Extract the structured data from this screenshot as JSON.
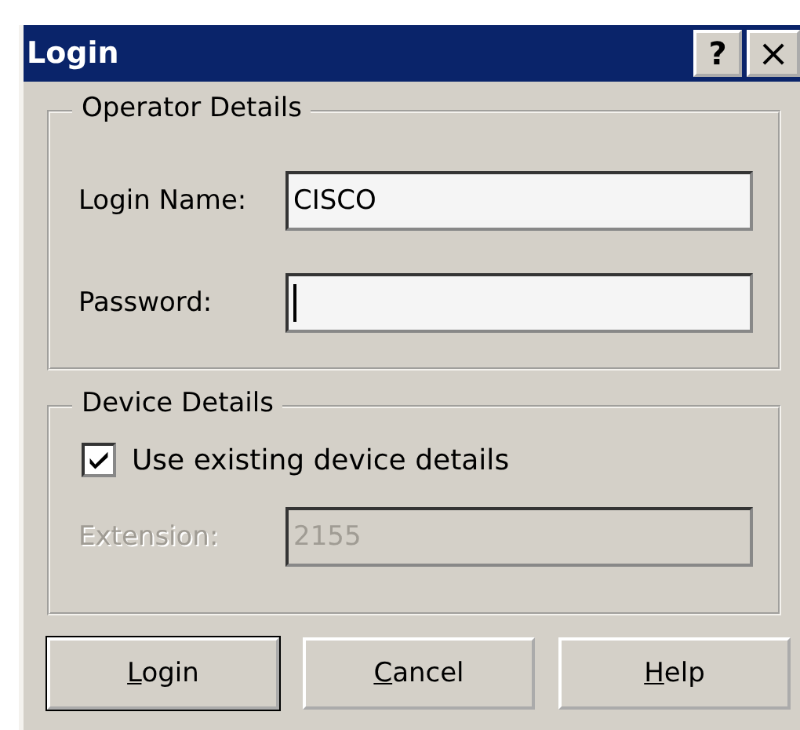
{
  "window": {
    "title": "Login",
    "title_buttons": [
      {
        "kind": "help",
        "label": "?"
      },
      {
        "kind": "close",
        "label": "×"
      }
    ]
  },
  "operator_details": {
    "legend": "Operator Details",
    "fields": [
      {
        "label": "Login Name:",
        "value": "CISCO",
        "focused": false
      },
      {
        "label": "Password:",
        "focused": true
      }
    ]
  },
  "device_details": {
    "legend": "Device Details",
    "checkbox": {
      "label": "Use existing device details",
      "checked": true
    },
    "extension": {
      "label": "Extension:",
      "value": "2155",
      "disabled": true
    }
  },
  "buttons": [
    {
      "label": "Login",
      "mnemonic": true,
      "default": true
    },
    {
      "label": "Cancel",
      "mnemonic": true,
      "default": false
    },
    {
      "label": "Help",
      "mnemonic": true,
      "default": false
    }
  ]
}
